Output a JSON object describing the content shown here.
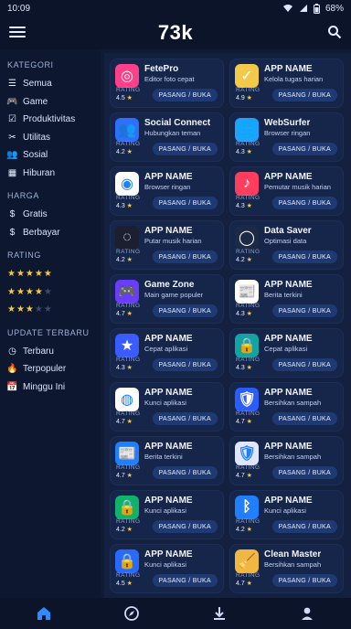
{
  "status": {
    "time": "10:09",
    "battery": "68%"
  },
  "header": {
    "title": "73k"
  },
  "sidebar": {
    "kategori_title": "KATEGORI",
    "kategori": [
      {
        "label": "Semua",
        "icon": "list-icon"
      },
      {
        "label": "Game",
        "icon": "gamepad-icon"
      },
      {
        "label": "Produktivitas",
        "icon": "checklist-icon"
      },
      {
        "label": "Utilitas",
        "icon": "tools-icon"
      },
      {
        "label": "Sosial",
        "icon": "people-icon"
      },
      {
        "label": "Hiburan",
        "icon": "film-icon"
      }
    ],
    "harga_title": "HARGA",
    "harga": [
      {
        "label": "Gratis",
        "icon": "dollar-icon"
      },
      {
        "label": "Berbayar",
        "icon": "dollar-icon"
      }
    ],
    "rating_title": "RATING",
    "rating_filters": [
      {
        "filled": "★★★★★",
        "empty": ""
      },
      {
        "filled": "★★★★",
        "empty": "★"
      },
      {
        "filled": "★★★",
        "empty": "★★"
      }
    ],
    "update_title": "UPDATE TERBARU",
    "update": [
      {
        "label": "Terbaru",
        "icon": "clock-icon"
      },
      {
        "label": "Terpopuler",
        "icon": "flame-icon"
      },
      {
        "label": "Minggu Ini",
        "icon": "calendar-icon"
      }
    ]
  },
  "apps": [
    {
      "name": "FetePro",
      "desc": "Editor foto cepat",
      "rating_label": "RATING",
      "rating": "4.5",
      "button": "PASANG / BUKA",
      "icon_color": "#ff3f8a",
      "icon_glyph": "◎"
    },
    {
      "name": "APP NAME",
      "desc": "Kelola tugas harian",
      "rating_label": "RATING",
      "rating": "4.9",
      "button": "PASANG / BUKA",
      "icon_color": "#f3c94a",
      "icon_glyph": "✓"
    },
    {
      "name": "Social Connect",
      "desc": "Hubungkan teman",
      "rating_label": "RATING",
      "rating": "4.2",
      "button": "PASANG / BUKA",
      "icon_color": "#2f6fff",
      "icon_glyph": "👥"
    },
    {
      "name": "WebSurfer",
      "desc": "Browser ringan",
      "rating_label": "RATING",
      "rating": "4.3",
      "button": "PASANG / BUKA",
      "icon_color": "#1fa2ff",
      "icon_glyph": "🌐"
    },
    {
      "name": "APP NAME",
      "desc": "Browser ringan",
      "rating_label": "RATING",
      "rating": "4.3",
      "button": "PASANG / BUKA",
      "icon_color": "#ffffff",
      "icon_glyph": "◉"
    },
    {
      "name": "APP NAME",
      "desc": "Pemutar musik harian",
      "rating_label": "RATING",
      "rating": "4.3",
      "button": "PASANG / BUKA",
      "icon_color": "#ff3d5f",
      "icon_glyph": "♪"
    },
    {
      "name": "APP NAME",
      "desc": "Putar musik harian",
      "rating_label": "RATING",
      "rating": "4.2",
      "button": "PASANG / BUKA",
      "icon_color": "#1b1f2f",
      "icon_glyph": "◌"
    },
    {
      "name": "Data Saver",
      "desc": "Optimasi data",
      "rating_label": "RATING",
      "rating": "4.2",
      "button": "PASANG / BUKA",
      "icon_color": "#1c2a48",
      "icon_glyph": "◯"
    },
    {
      "name": "Game Zone",
      "desc": "Main game populer",
      "rating_label": "RATING",
      "rating": "4.7",
      "button": "PASANG / BUKA",
      "icon_color": "#6a3cff",
      "icon_glyph": "🎮"
    },
    {
      "name": "APP NAME",
      "desc": "Berita terkini",
      "rating_label": "RATING",
      "rating": "4.3",
      "button": "PASANG / BUKA",
      "icon_color": "#ffffff",
      "icon_glyph": "📰"
    },
    {
      "name": "APP NAME",
      "desc": "Cepat aplikasi",
      "rating_label": "RATING",
      "rating": "4.3",
      "button": "PASANG / BUKA",
      "icon_color": "#3a5bff",
      "icon_glyph": "★"
    },
    {
      "name": "APP NAME",
      "desc": "Cepat aplikasi",
      "rating_label": "RATING",
      "rating": "4.3",
      "button": "PASANG / BUKA",
      "icon_color": "#12a3a3",
      "icon_glyph": "🔒"
    },
    {
      "name": "APP NAME",
      "desc": "Kunci aplikasi",
      "rating_label": "RATING",
      "rating": "4.7",
      "button": "PASANG / BUKA",
      "icon_color": "#ffffff",
      "icon_glyph": "◍"
    },
    {
      "name": "APP NAME",
      "desc": "Bersihkan sampah",
      "rating_label": "RATING",
      "rating": "4.7",
      "button": "PASANG / BUKA",
      "icon_color": "#2b5cff",
      "icon_glyph": "🛡"
    },
    {
      "name": "APP NAME",
      "desc": "Berita terkini",
      "rating_label": "RATING",
      "rating": "4.7",
      "button": "PASANG / BUKA",
      "icon_color": "#1f7fff",
      "icon_glyph": "📰"
    },
    {
      "name": "APP NAME",
      "desc": "Bersihkan sampah",
      "rating_label": "RATING",
      "rating": "4.7",
      "button": "PASANG / BUKA",
      "icon_color": "#e0e6ff",
      "icon_glyph": "🛡"
    },
    {
      "name": "APP NAME",
      "desc": "Kunci aplikasi",
      "rating_label": "RATING",
      "rating": "4.2",
      "button": "PASANG / BUKA",
      "icon_color": "#0fb36c",
      "icon_glyph": "🔒"
    },
    {
      "name": "APP NAME",
      "desc": "Kunci aplikasi",
      "rating_label": "RATING",
      "rating": "4.2",
      "button": "PASANG / BUKA",
      "icon_color": "#1f7fff",
      "icon_glyph": "ᛒ"
    },
    {
      "name": "APP NAME",
      "desc": "Kunci aplikasi",
      "rating_label": "RATING",
      "rating": "4.5",
      "button": "PASANG / BUKA",
      "icon_color": "#2a69ff",
      "icon_glyph": "🔒"
    },
    {
      "name": "Clean Master",
      "desc": "Bersihkan sampah",
      "rating_label": "RATING",
      "rating": "4.7",
      "button": "PASANG / BUKA",
      "icon_color": "#f0b840",
      "icon_glyph": "🧹"
    }
  ],
  "bottom_nav": [
    {
      "icon": "home-icon",
      "active": true
    },
    {
      "icon": "compass-icon",
      "active": false
    },
    {
      "icon": "download-icon",
      "active": false
    },
    {
      "icon": "profile-icon",
      "active": false
    }
  ]
}
